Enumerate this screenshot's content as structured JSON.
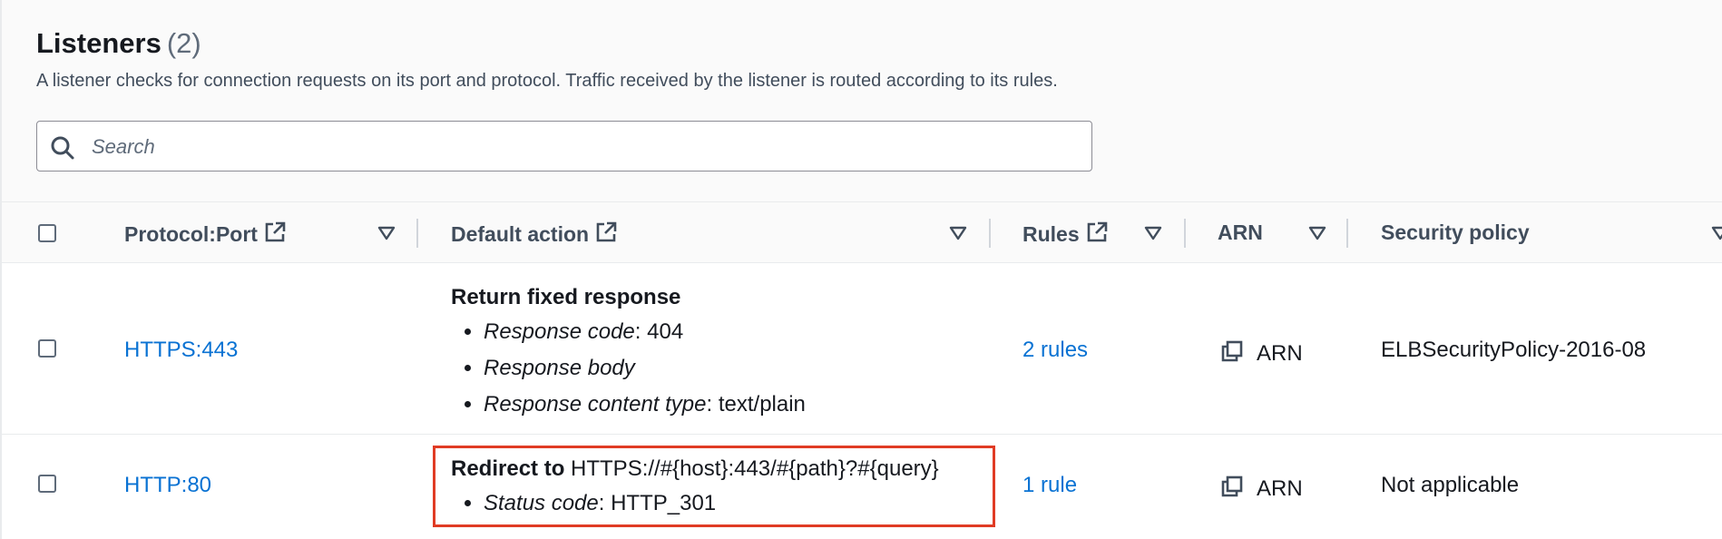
{
  "section": {
    "title": "Listeners",
    "count": "(2)",
    "description": "A listener checks for connection requests on its port and protocol. Traffic received by the listener is routed according to its rules."
  },
  "search": {
    "placeholder": "Search",
    "value": ""
  },
  "columns": {
    "protocol_port": "Protocol:Port",
    "default_action": "Default action",
    "rules": "Rules",
    "arn": "ARN",
    "security_policy": "Security policy"
  },
  "rows": [
    {
      "protocol_port": "HTTPS:443",
      "action_title": "Return fixed response",
      "bullets": [
        {
          "key": "Response code",
          "value": ": 404"
        },
        {
          "key": "Response body",
          "value": ""
        },
        {
          "key": "Response content type",
          "value": ": text/plain"
        }
      ],
      "rules": "2 rules",
      "arn": "ARN",
      "security_policy": "ELBSecurityPolicy-2016-08"
    },
    {
      "protocol_port": "HTTP:80",
      "action_title": "Redirect to",
      "action_target": "HTTPS://#{host}:443/#{path}?#{query}",
      "bullets": [
        {
          "key": "Status code",
          "value": ": HTTP_301"
        }
      ],
      "rules": "1 rule",
      "arn": "ARN",
      "security_policy": "Not applicable"
    }
  ],
  "colors": {
    "link": "#0972d3",
    "highlight": "#e03b24"
  },
  "icons": {
    "search": "search-icon",
    "external": "external-link-icon",
    "sort": "sort-down-icon",
    "copy": "copy-icon"
  }
}
